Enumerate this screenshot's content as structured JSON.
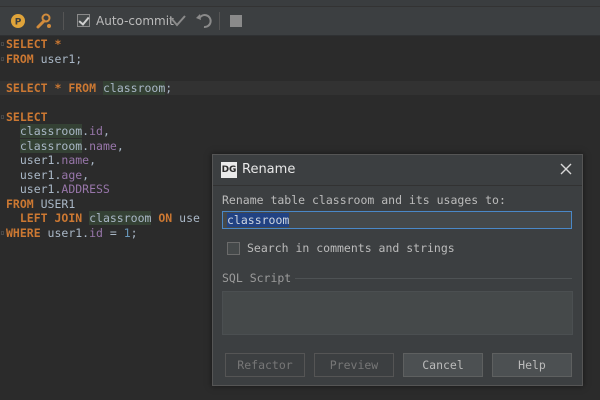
{
  "toolbar": {
    "autocommit_label": "Auto-commit",
    "autocommit_checked": true
  },
  "editor": {
    "lines": [
      {
        "tokens": [
          {
            "t": "SELECT",
            "c": "kw"
          },
          {
            "t": " *",
            "c": "kw"
          }
        ]
      },
      {
        "tokens": [
          {
            "t": "FROM",
            "c": "kw"
          },
          {
            "t": " user1;",
            "c": "txt"
          }
        ]
      },
      {
        "tokens": []
      },
      {
        "tokens": [
          {
            "t": "SELECT",
            "c": "kw"
          },
          {
            "t": " * ",
            "c": "kw"
          },
          {
            "t": "FROM",
            "c": "kw"
          },
          {
            "t": " ",
            "c": "txt"
          },
          {
            "t": "classroom",
            "c": "tbl"
          },
          {
            "t": ";",
            "c": "txt"
          }
        ],
        "hl": true
      },
      {
        "tokens": []
      },
      {
        "tokens": [
          {
            "t": "SELECT",
            "c": "kw"
          }
        ]
      },
      {
        "tokens": [
          {
            "t": "  ",
            "c": "txt"
          },
          {
            "t": "classroom",
            "c": "tbl"
          },
          {
            "t": ".",
            "c": "txt"
          },
          {
            "t": "id",
            "c": "col"
          },
          {
            "t": ",",
            "c": "txt"
          }
        ]
      },
      {
        "tokens": [
          {
            "t": "  ",
            "c": "txt"
          },
          {
            "t": "classroom",
            "c": "tbl"
          },
          {
            "t": ".",
            "c": "txt"
          },
          {
            "t": "name",
            "c": "col"
          },
          {
            "t": ",",
            "c": "txt"
          }
        ]
      },
      {
        "tokens": [
          {
            "t": "  user1.",
            "c": "txt"
          },
          {
            "t": "name",
            "c": "col"
          },
          {
            "t": ",",
            "c": "txt"
          }
        ]
      },
      {
        "tokens": [
          {
            "t": "  user1.",
            "c": "txt"
          },
          {
            "t": "age",
            "c": "col"
          },
          {
            "t": ",",
            "c": "txt"
          }
        ]
      },
      {
        "tokens": [
          {
            "t": "  user1.",
            "c": "txt"
          },
          {
            "t": "ADDRESS",
            "c": "col"
          }
        ]
      },
      {
        "tokens": [
          {
            "t": "FROM",
            "c": "kw"
          },
          {
            "t": " USER1",
            "c": "txt"
          }
        ]
      },
      {
        "tokens": [
          {
            "t": "  ",
            "c": "txt"
          },
          {
            "t": "LEFT JOIN",
            "c": "kw"
          },
          {
            "t": " ",
            "c": "txt"
          },
          {
            "t": "classroom",
            "c": "tbl"
          },
          {
            "t": " ",
            "c": "txt"
          },
          {
            "t": "ON",
            "c": "kw"
          },
          {
            "t": " use",
            "c": "txt"
          }
        ]
      },
      {
        "tokens": [
          {
            "t": "WHERE",
            "c": "kw"
          },
          {
            "t": " user1.",
            "c": "txt"
          },
          {
            "t": "id",
            "c": "col"
          },
          {
            "t": " = ",
            "c": "txt"
          },
          {
            "t": "1",
            "c": "num"
          },
          {
            "t": ";",
            "c": "txt"
          }
        ]
      }
    ]
  },
  "dialog": {
    "logo": "DG",
    "title": "Rename",
    "prompt": "Rename table classroom and its usages to:",
    "input_value": "classroom",
    "search_label": "Search in comments and strings",
    "search_checked": false,
    "section_label": "SQL Script",
    "buttons": {
      "refactor": "Refactor",
      "preview": "Preview",
      "cancel": "Cancel",
      "help": "Help"
    }
  }
}
